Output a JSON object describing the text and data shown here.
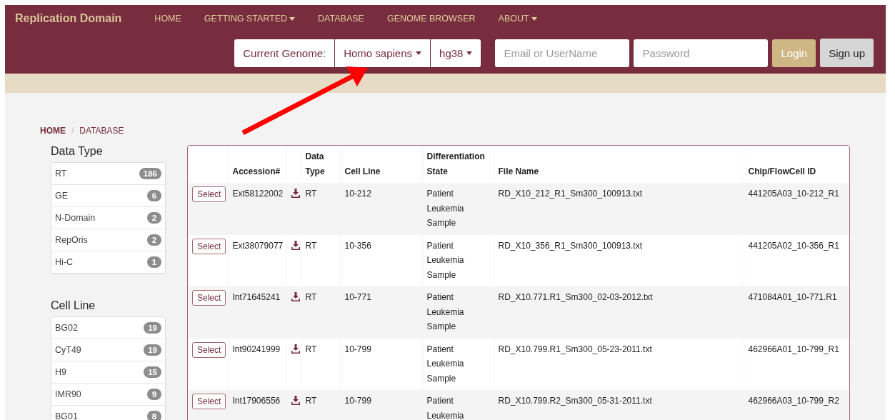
{
  "navbar": {
    "brand": "Replication Domain",
    "menu": [
      {
        "label": "HOME",
        "dropdown": false
      },
      {
        "label": "GETTING STARTED",
        "dropdown": true
      },
      {
        "label": "DATABASE",
        "dropdown": false
      },
      {
        "label": "GENOME BROWSER",
        "dropdown": false
      },
      {
        "label": "ABOUT",
        "dropdown": true
      }
    ],
    "genome": {
      "label": "Current Genome:",
      "species": "Homo sapiens",
      "assembly": "hg38"
    },
    "login": {
      "user_placeholder": "Email or UserName",
      "password_placeholder": "Password",
      "login_button": "Login",
      "signup_button": "Sign up"
    }
  },
  "breadcrumb": {
    "separator": "/",
    "items": [
      {
        "label": "HOME",
        "selected": false
      },
      {
        "label": "DATABASE",
        "selected": true
      }
    ]
  },
  "facets": [
    {
      "title": "Data Type",
      "items": [
        {
          "label": "RT",
          "count": "186"
        },
        {
          "label": "GE",
          "count": "6"
        },
        {
          "label": "N-Domain",
          "count": "2"
        },
        {
          "label": "RepOris",
          "count": "2"
        },
        {
          "label": "Hi-C",
          "count": "1"
        }
      ]
    },
    {
      "title": "Cell Line",
      "items": [
        {
          "label": "BG02",
          "count": "19"
        },
        {
          "label": "CyT49",
          "count": "19"
        },
        {
          "label": "H9",
          "count": "15"
        },
        {
          "label": "IMR90",
          "count": "9"
        },
        {
          "label": "BG01",
          "count": "8"
        }
      ]
    }
  ],
  "table": {
    "columns": [
      "Accession#",
      "Data Type",
      "Cell Line",
      "Differentiation State",
      "File Name",
      "Chip/FlowCell ID"
    ],
    "rows": [
      {
        "select": "Select",
        "accession": "Ext58122002",
        "data_type": "RT",
        "cell_line": "10-212",
        "state": "Patient Leukemia Sample",
        "file_name": "RD_X10_212_R1_Sm300_100913.txt",
        "chip_id": "441205A03_10-212_R1"
      },
      {
        "select": "Select",
        "accession": "Ext38079077",
        "data_type": "RT",
        "cell_line": "10-356",
        "state": "Patient Leukemia Sample",
        "file_name": "RD_X10_356_R1_Sm300_100913.txt",
        "chip_id": "441205A02_10-356_R1"
      },
      {
        "select": "Select",
        "accession": "Int71645241",
        "data_type": "RT",
        "cell_line": "10-771",
        "state": "Patient Leukemia Sample",
        "file_name": "RD_X10.771.R1_Sm300_02-03-2012.txt",
        "chip_id": "471084A01_10-771.R1"
      },
      {
        "select": "Select",
        "accession": "Int90241999",
        "data_type": "RT",
        "cell_line": "10-799",
        "state": "Patient Leukemia Sample",
        "file_name": "RD_X10.799.R1_Sm300_05-23-2011.txt",
        "chip_id": "462966A01_10-799_R1"
      },
      {
        "select": "Select",
        "accession": "Int17906556",
        "data_type": "RT",
        "cell_line": "10-799",
        "state": "Patient Leukemia",
        "file_name": "RD_X10.799.R2_Sm300_05-31-2011.txt",
        "chip_id": "462966A03_10-799_R2"
      }
    ]
  }
}
